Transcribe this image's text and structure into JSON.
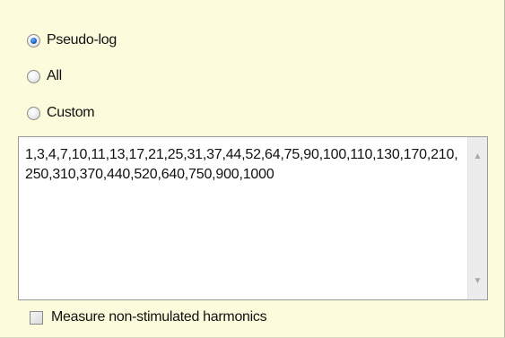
{
  "range_options": {
    "pseudo_log_label": "Pseudo-log",
    "all_label": "All",
    "custom_label": "Custom",
    "selected": "Pseudo-log"
  },
  "custom_textbox": {
    "value": "1,3,4,7,10,11,13,17,21,25,31,37,44,52,64,75,90,100,110,130,170,210,250,310,370,440,520,640,750,900,1000"
  },
  "scrollbar": {
    "up_glyph": "▲",
    "down_glyph": "▼"
  },
  "options": {
    "measure_non_stimulated_label": "Measure non-stimulated harmonics",
    "measure_non_stimulated_checked": false
  }
}
